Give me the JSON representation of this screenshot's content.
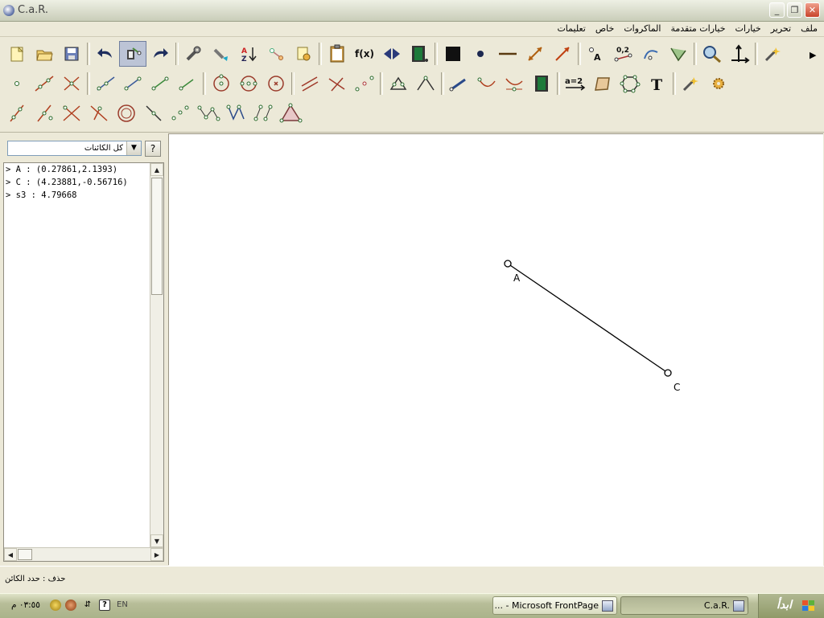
{
  "window": {
    "title": "C.a.R.",
    "minimize": "_",
    "maximize": "❐",
    "close": "✕"
  },
  "menu": [
    "ملف",
    "تحرير",
    "خيارات",
    "خيارات متقدمة",
    "الماكروات",
    "خاص",
    "تعليمات"
  ],
  "left_panel": {
    "filter_selected": "كل الكائنات",
    "help_label": "?",
    "objects": [
      "> A : (0.27861,2.1393)",
      "> C : (4.23881,-0.56716)",
      "> s3 : 4.79668"
    ]
  },
  "canvas": {
    "points": [
      {
        "label": "A",
        "x": 0.27861,
        "y": 2.1393
      },
      {
        "label": "C",
        "x": 4.23881,
        "y": -0.56716
      }
    ],
    "segment": {
      "name": "s3",
      "from": "A",
      "to": "C",
      "length": 4.79668
    }
  },
  "status": {
    "text": "حذف : حدد الكائن"
  },
  "taskbar": {
    "clock": "٠٣:٥٥ م",
    "lang": "EN",
    "apps": [
      "... - Microsoft FrontPage",
      "C.a.R."
    ],
    "start_label": "ابدأ"
  },
  "colors": {
    "accent_active": "#bcc4d6",
    "point_fill": "#ffffff",
    "line": "#000000"
  }
}
